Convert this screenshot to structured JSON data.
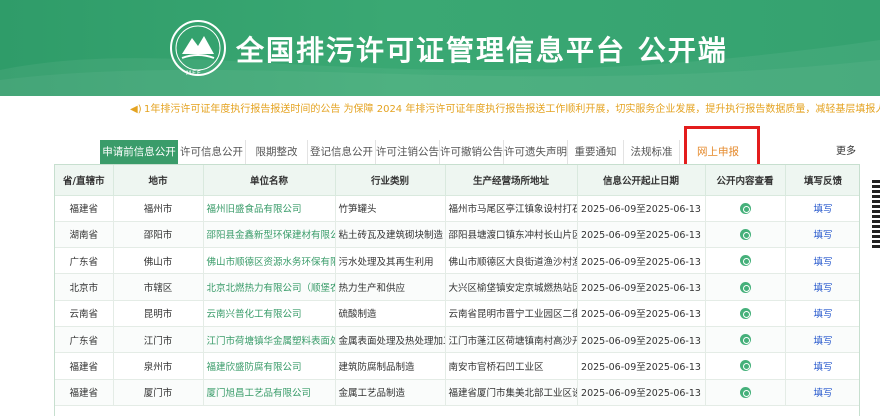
{
  "header": {
    "title": "全国排污许可证管理信息平台  公开端",
    "logo_text": "MEE"
  },
  "notice": {
    "text": "1年排污许可证年度执行报告报送时间的公告 为保障 2024 年排污许可证年度执行报告报送工作顺利开展，切实服务企业发展，提升执行报告数据质量，减轻基层填报人员负担。"
  },
  "tabs": [
    {
      "label": "申请前信息公开"
    },
    {
      "label": "许可信息公开"
    },
    {
      "label": "限期整改"
    },
    {
      "label": "登记信息公开"
    },
    {
      "label": "许可注销公告"
    },
    {
      "label": "许可撤销公告"
    },
    {
      "label": "许可遗失声明"
    },
    {
      "label": "重要通知"
    },
    {
      "label": "法规标准"
    },
    {
      "label": "网上申报"
    }
  ],
  "more_label": "更多",
  "table": {
    "headers": [
      "省/直辖市",
      "地市",
      "单位名称",
      "行业类别",
      "生产经营场所地址",
      "信息公开起止日期",
      "公开内容查看",
      "填写反馈"
    ],
    "rows": [
      {
        "province": "福建省",
        "city": "福州市",
        "company": "福州旧盛食品有限公司",
        "industry": "竹笋罐头",
        "address": "福州市马尾区亭江镇象设村打石坑...",
        "dates": "2025-06-09至2025-06-13",
        "feedback": "填写"
      },
      {
        "province": "湖南省",
        "city": "邵阳市",
        "company": "邵阳县金鑫新型环保建材有限公司",
        "industry": "粘土砖瓦及建筑砌块制造",
        "address": "邵阳县塘渡口镇东冲村长山片区",
        "dates": "2025-06-09至2025-06-13",
        "feedback": "填写"
      },
      {
        "province": "广东省",
        "city": "佛山市",
        "company": "佛山市顺德区资源水务环保有限...",
        "industry": "污水处理及其再生利用",
        "address": "佛山市顺德区大良街道渔沙村渔沙...",
        "dates": "2025-06-09至2025-06-13",
        "feedback": "填写"
      },
      {
        "province": "北京市",
        "city": "市辖区",
        "company": "北京北燃热力有限公司（顺堡农...",
        "industry": "热力生产和供应",
        "address": "大兴区榆垡镇安定京城燃热站区...",
        "dates": "2025-06-09至2025-06-13",
        "feedback": "填写"
      },
      {
        "province": "云南省",
        "city": "昆明市",
        "company": "云南兴普化工有限公司",
        "industry": "硫酸制造",
        "address": "云南省昆明市晋宁工业园区二街基地",
        "dates": "2025-06-09至2025-06-13",
        "feedback": "填写"
      },
      {
        "province": "广东省",
        "city": "江门市",
        "company": "江门市荷塘镇华金属塑料表面处...",
        "industry": "金属表面处理及热处理加工",
        "address": "江门市蓬江区荷塘镇南村高沙开发区",
        "dates": "2025-06-09至2025-06-13",
        "feedback": "填写"
      },
      {
        "province": "福建省",
        "city": "泉州市",
        "company": "福建欣盛防腐有限公司",
        "industry": "建筑防腐制品制造",
        "address": "南安市官桥石凹工业区",
        "dates": "2025-06-09至2025-06-13",
        "feedback": "填写"
      },
      {
        "province": "福建省",
        "city": "厦门市",
        "company": "厦门旭昌工艺品有限公司",
        "industry": "金属工艺品制造",
        "address": "福建省厦门市集美北部工业区设田...",
        "dates": "2025-06-09至2025-06-13",
        "feedback": "填写"
      }
    ]
  },
  "colors": {
    "banner": "#35a270",
    "active_tab": "#3a9c6a",
    "highlight_tab": "#e58a2c",
    "highlight_box": "#e31d1d",
    "link_blue": "#2255cc"
  }
}
